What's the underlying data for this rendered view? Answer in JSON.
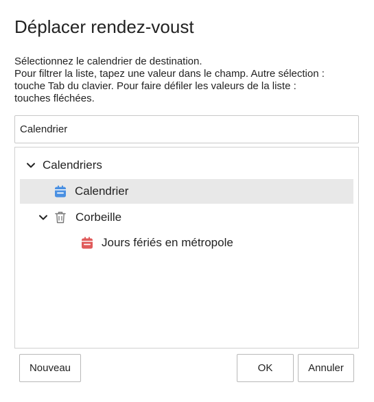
{
  "dialog": {
    "title": "Déplacer rendez-voust",
    "instructions": [
      "Sélectionnez le calendrier de destination.",
      "Pour filtrer la liste, tapez une valeur dans le champ. Autre sélection :",
      "touche Tab du clavier. Pour faire défiler les valeurs de la liste :",
      "touches fléchées."
    ],
    "filter": {
      "value": "Calendrier"
    },
    "tree": {
      "root": {
        "label": "Calendriers",
        "expanded": true
      },
      "calendar": {
        "label": "Calendrier",
        "icon": "calendar-icon",
        "icon_color": "#4a90e2",
        "selected": true
      },
      "trash": {
        "label": "Corbeille",
        "icon": "trash-icon",
        "expanded": true
      },
      "holidays": {
        "label": "Jours fériés en métropole",
        "icon": "calendar-icon",
        "icon_color": "#e05b5b"
      }
    },
    "buttons": {
      "new": "Nouveau",
      "ok": "OK",
      "cancel": "Annuler"
    }
  }
}
